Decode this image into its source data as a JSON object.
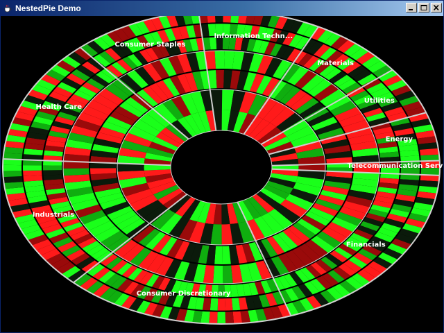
{
  "window": {
    "title": "NestedPie Demo",
    "icon": "java-cup-icon",
    "controls": [
      "minimize-icon",
      "maximize-icon",
      "close-icon"
    ]
  },
  "colors": {
    "background": "#000000",
    "high": "#1aff1a",
    "mid_green": "#0fae0f",
    "dark": "#0b1a0b",
    "mid_red": "#9a0a0a",
    "low": "#ff1a1a",
    "separator": "#cfcfcf"
  },
  "chart_data": {
    "type": "nested-pie",
    "rings": 3,
    "center": "empty",
    "sectors": [
      {
        "label": "Information Technology",
        "display_label": "Information Techn...",
        "share": 9
      },
      {
        "label": "Materials",
        "share": 7
      },
      {
        "label": "Utilities",
        "share": 5
      },
      {
        "label": "Energy",
        "share": 5
      },
      {
        "label": "Telecommunication Services",
        "share": 1.5
      },
      {
        "label": "Financials",
        "share": 19
      },
      {
        "label": "Consumer Discretionary",
        "share": 17
      },
      {
        "label": "Industrials",
        "share": 14
      },
      {
        "label": "Health Care",
        "share": 13
      },
      {
        "label": "Consumer Staples",
        "share": 9.5
      }
    ]
  }
}
